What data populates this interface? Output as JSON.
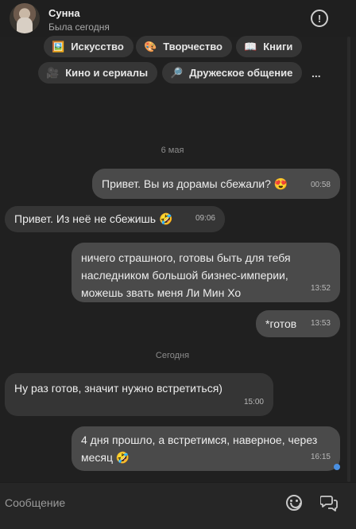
{
  "header": {
    "name": "Сунна",
    "status": "Была сегодня",
    "info_icon": "info-icon",
    "info_glyph": "!"
  },
  "interests": [
    {
      "emoji": "🖼️",
      "label": "Искусство"
    },
    {
      "emoji": "🎨",
      "label": "Творчество"
    },
    {
      "emoji": "📖",
      "label": "Книги"
    },
    {
      "emoji": "🎥",
      "label": "Кино и сериалы"
    },
    {
      "emoji": "🔎",
      "label": "Дружеское общение"
    }
  ],
  "interests_more": "...",
  "dates": [
    "6 мая",
    "Сегодня"
  ],
  "messages": [
    {
      "dir": "out",
      "text": "Привет. Вы из дорамы сбежали? 😍",
      "time": "00:58"
    },
    {
      "dir": "in",
      "text": "Привет. Из неё не сбежишь 🤣",
      "time": "09:06"
    },
    {
      "dir": "out",
      "text": "ничего страшного, готовы быть для тебя наследником большой бизнес-империи, можешь звать меня Ли Мин Хо",
      "time": "13:52"
    },
    {
      "dir": "out",
      "text": "*готов",
      "time": "13:53"
    },
    {
      "dir": "in",
      "text": "Ну раз готов, значит нужно встретиться)",
      "time": "15:00"
    },
    {
      "dir": "out",
      "text": "4 дня прошло, а встретимся, наверное, через месяц 🤣",
      "time": "16:15"
    }
  ],
  "composer": {
    "placeholder": "Сообщение",
    "value": "",
    "emoji_icon": "smile-icon",
    "chat_icon": "chat-bubbles-icon"
  },
  "colors": {
    "background": "#202020",
    "bubble_out": "#4a4a4a",
    "bubble_in": "#353535",
    "read_indicator": "#4a90e2"
  }
}
